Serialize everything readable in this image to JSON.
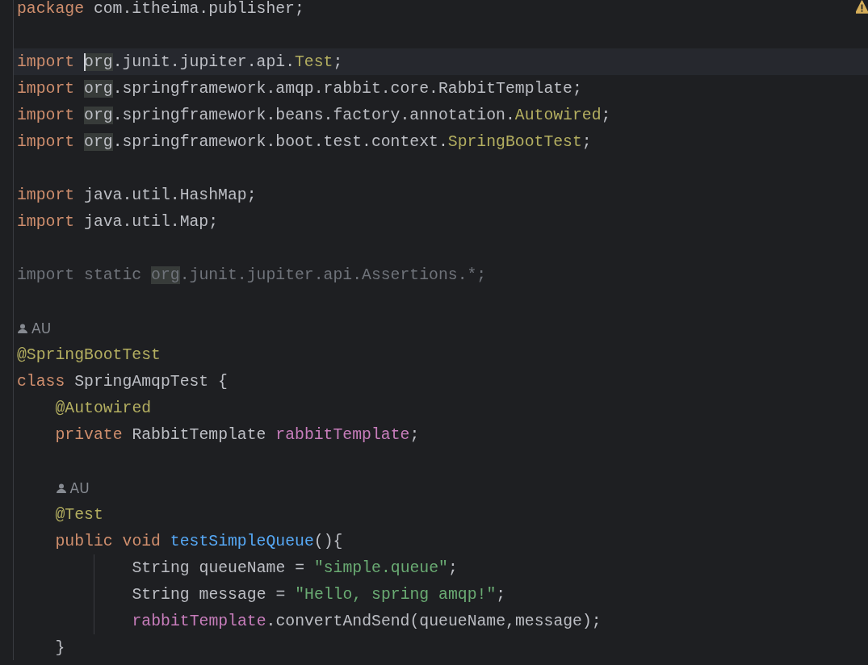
{
  "editor": {
    "warning": true,
    "lines": [
      {
        "kind": "code",
        "current": false,
        "tokens": [
          {
            "text": "package",
            "kind": "keyword",
            "highlighted": false,
            "caret": false
          },
          {
            "text": " com.itheima.publisher;",
            "kind": "plain",
            "highlighted": false,
            "caret": false
          }
        ]
      },
      {
        "kind": "blank"
      },
      {
        "kind": "code",
        "current": true,
        "tokens": [
          {
            "text": "import ",
            "kind": "keyword",
            "highlighted": false,
            "caret": false
          },
          {
            "text": "org",
            "kind": "plain",
            "highlighted": true,
            "caret": true
          },
          {
            "text": ".junit.jupiter.api.",
            "kind": "plain",
            "highlighted": false,
            "caret": false
          },
          {
            "text": "Test",
            "kind": "annotation",
            "highlighted": false,
            "caret": false
          },
          {
            "text": ";",
            "kind": "plain",
            "highlighted": false,
            "caret": false
          }
        ]
      },
      {
        "kind": "code",
        "current": false,
        "tokens": [
          {
            "text": "import ",
            "kind": "keyword",
            "highlighted": false,
            "caret": false
          },
          {
            "text": "org",
            "kind": "plain",
            "highlighted": true,
            "caret": false
          },
          {
            "text": ".springframework.amqp.rabbit.core.RabbitTemplate;",
            "kind": "plain",
            "highlighted": false,
            "caret": false
          }
        ]
      },
      {
        "kind": "code",
        "current": false,
        "tokens": [
          {
            "text": "import ",
            "kind": "keyword",
            "highlighted": false,
            "caret": false
          },
          {
            "text": "org",
            "kind": "plain",
            "highlighted": true,
            "caret": false
          },
          {
            "text": ".springframework.beans.factory.annotation.",
            "kind": "plain",
            "highlighted": false,
            "caret": false
          },
          {
            "text": "Autowired",
            "kind": "annotation",
            "highlighted": false,
            "caret": false
          },
          {
            "text": ";",
            "kind": "plain",
            "highlighted": false,
            "caret": false
          }
        ]
      },
      {
        "kind": "code",
        "current": false,
        "tokens": [
          {
            "text": "import ",
            "kind": "keyword",
            "highlighted": false,
            "caret": false
          },
          {
            "text": "org",
            "kind": "plain",
            "highlighted": true,
            "caret": false
          },
          {
            "text": ".springframework.boot.test.context.",
            "kind": "plain",
            "highlighted": false,
            "caret": false
          },
          {
            "text": "SpringBootTest",
            "kind": "annotation",
            "highlighted": false,
            "caret": false
          },
          {
            "text": ";",
            "kind": "plain",
            "highlighted": false,
            "caret": false
          }
        ]
      },
      {
        "kind": "blank"
      },
      {
        "kind": "code",
        "current": false,
        "tokens": [
          {
            "text": "import",
            "kind": "keyword",
            "highlighted": false,
            "caret": false
          },
          {
            "text": " java.util.HashMap;",
            "kind": "plain",
            "highlighted": false,
            "caret": false
          }
        ]
      },
      {
        "kind": "code",
        "current": false,
        "tokens": [
          {
            "text": "import",
            "kind": "keyword",
            "highlighted": false,
            "caret": false
          },
          {
            "text": " java.util.Map;",
            "kind": "plain",
            "highlighted": false,
            "caret": false
          }
        ]
      },
      {
        "kind": "blank"
      },
      {
        "kind": "code",
        "current": false,
        "tokens": [
          {
            "text": "import static ",
            "kind": "unused",
            "highlighted": false,
            "caret": false
          },
          {
            "text": "org",
            "kind": "unused",
            "highlighted": true,
            "caret": false
          },
          {
            "text": ".junit.jupiter.api.Assertions.*;",
            "kind": "unused",
            "highlighted": false,
            "caret": false
          }
        ]
      },
      {
        "kind": "blank"
      },
      {
        "kind": "hint",
        "text": "AU"
      },
      {
        "kind": "code",
        "current": false,
        "tokens": [
          {
            "text": "@SpringBootTest",
            "kind": "annotation",
            "highlighted": false,
            "caret": false
          }
        ]
      },
      {
        "kind": "code",
        "current": false,
        "tokens": [
          {
            "text": "class",
            "kind": "keyword",
            "highlighted": false,
            "caret": false
          },
          {
            "text": " SpringAmqpTest {",
            "kind": "plain",
            "highlighted": false,
            "caret": false
          }
        ],
        "children": [
          {
            "kind": "code",
            "current": false,
            "tokens": [
              {
                "text": "@Autowired",
                "kind": "annotation",
                "highlighted": false,
                "caret": false
              }
            ]
          },
          {
            "kind": "code",
            "current": false,
            "tokens": [
              {
                "text": "private",
                "kind": "keyword",
                "highlighted": false,
                "caret": false
              },
              {
                "text": " RabbitTemplate ",
                "kind": "plain",
                "highlighted": false,
                "caret": false
              },
              {
                "text": "rabbitTemplate",
                "kind": "field",
                "highlighted": false,
                "caret": false
              },
              {
                "text": ";",
                "kind": "plain",
                "highlighted": false,
                "caret": false
              }
            ]
          },
          {
            "kind": "blank"
          },
          {
            "kind": "hint",
            "text": "AU"
          },
          {
            "kind": "code",
            "current": false,
            "tokens": [
              {
                "text": "@Test",
                "kind": "annotation",
                "highlighted": false,
                "caret": false
              }
            ]
          },
          {
            "kind": "code",
            "current": false,
            "tokens": [
              {
                "text": "public void ",
                "kind": "keyword",
                "highlighted": false,
                "caret": false
              },
              {
                "text": "testSimpleQueue",
                "kind": "method",
                "highlighted": false,
                "caret": false
              },
              {
                "text": "(){",
                "kind": "plain",
                "highlighted": false,
                "caret": false
              }
            ],
            "children": [
              {
                "kind": "code",
                "current": false,
                "tokens": [
                  {
                    "text": "String queueName = ",
                    "kind": "plain",
                    "highlighted": false,
                    "caret": false
                  },
                  {
                    "text": "\"simple.queue\"",
                    "kind": "string",
                    "highlighted": false,
                    "caret": false
                  },
                  {
                    "text": ";",
                    "kind": "plain",
                    "highlighted": false,
                    "caret": false
                  }
                ]
              },
              {
                "kind": "code",
                "current": false,
                "tokens": [
                  {
                    "text": "String message = ",
                    "kind": "plain",
                    "highlighted": false,
                    "caret": false
                  },
                  {
                    "text": "\"Hello, spring amqp!\"",
                    "kind": "string",
                    "highlighted": false,
                    "caret": false
                  },
                  {
                    "text": ";",
                    "kind": "plain",
                    "highlighted": false,
                    "caret": false
                  }
                ]
              },
              {
                "kind": "code",
                "current": false,
                "tokens": [
                  {
                    "text": "rabbitTemplate",
                    "kind": "field",
                    "highlighted": false,
                    "caret": false
                  },
                  {
                    "text": ".convertAndSend(queueName,message);",
                    "kind": "plain",
                    "highlighted": false,
                    "caret": false
                  }
                ]
              }
            ]
          },
          {
            "kind": "code",
            "current": false,
            "tokens": [
              {
                "text": "}",
                "kind": "plain",
                "highlighted": false,
                "caret": false
              }
            ]
          }
        ]
      }
    ]
  }
}
